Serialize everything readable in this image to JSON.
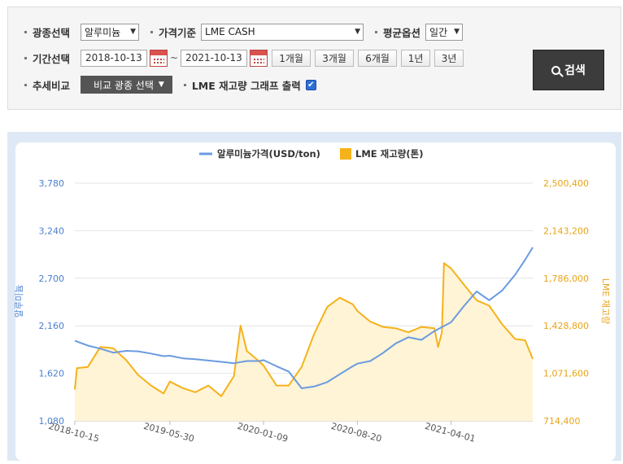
{
  "filters": {
    "metal_label": "광종선택",
    "metal_value": "알루미늄",
    "price_label": "가격기준",
    "price_value": "LME CASH",
    "avg_label": "평균옵션",
    "avg_value": "일간",
    "period_label": "기간선택",
    "date_from": "2018-10-13",
    "date_sep": "~",
    "date_to": "2021-10-13",
    "period_buttons": [
      "1개월",
      "3개월",
      "6개월",
      "1년",
      "3년"
    ],
    "trend_label": "추세비교",
    "compare_button": "비교 광종 선택",
    "inventory_label": "LME 재고량 그래프 출력",
    "inventory_checked": true,
    "search_button": "검색"
  },
  "chart_data": {
    "type": "line",
    "legend_position": "top-center",
    "grid": "horizontal",
    "series": [
      {
        "name": "알루미늄가격(USD/ton)",
        "axis": "left",
        "color": "#6a9be0",
        "x": [
          "2018-10-15",
          "2018-11-15",
          "2018-12-15",
          "2019-01-15",
          "2019-02-15",
          "2019-03-15",
          "2019-04-15",
          "2019-05-15",
          "2019-05-30",
          "2019-06-30",
          "2019-07-30",
          "2019-08-30",
          "2019-09-30",
          "2019-10-30",
          "2019-11-30",
          "2019-12-30",
          "2020-01-09",
          "2020-02-09",
          "2020-03-09",
          "2020-04-09",
          "2020-05-09",
          "2020-06-09",
          "2020-07-09",
          "2020-08-09",
          "2020-08-20",
          "2020-09-20",
          "2020-10-20",
          "2020-11-20",
          "2020-12-20",
          "2021-01-20",
          "2021-02-20",
          "2021-04-01",
          "2021-05-01",
          "2021-06-01",
          "2021-07-01",
          "2021-08-01",
          "2021-09-01",
          "2021-09-25",
          "2021-10-13"
        ],
        "y": [
          1990,
          1935,
          1900,
          1855,
          1875,
          1870,
          1845,
          1815,
          1820,
          1790,
          1780,
          1765,
          1750,
          1735,
          1760,
          1760,
          1770,
          1700,
          1640,
          1450,
          1470,
          1520,
          1610,
          1700,
          1730,
          1760,
          1850,
          1960,
          2030,
          2000,
          2100,
          2200,
          2380,
          2550,
          2450,
          2560,
          2740,
          2910,
          3050
        ]
      },
      {
        "name": "LME 재고량(톤)",
        "axis": "right",
        "color": "#f5b21b",
        "x": [
          "2018-10-15",
          "2018-10-20",
          "2018-11-15",
          "2018-12-15",
          "2019-01-15",
          "2019-02-15",
          "2019-03-15",
          "2019-04-15",
          "2019-05-15",
          "2019-05-30",
          "2019-06-30",
          "2019-07-30",
          "2019-08-30",
          "2019-09-30",
          "2019-10-30",
          "2019-11-15",
          "2019-11-30",
          "2019-12-30",
          "2020-01-09",
          "2020-02-09",
          "2020-03-09",
          "2020-04-09",
          "2020-05-09",
          "2020-06-09",
          "2020-07-09",
          "2020-08-09",
          "2020-08-20",
          "2020-09-20",
          "2020-10-20",
          "2020-11-20",
          "2020-12-20",
          "2021-01-20",
          "2021-02-20",
          "2021-03-01",
          "2021-03-10",
          "2021-03-15",
          "2021-04-01",
          "2021-05-01",
          "2021-06-01",
          "2021-07-01",
          "2021-08-01",
          "2021-09-01",
          "2021-09-25",
          "2021-10-13"
        ],
        "y": [
          950,
          1110,
          1120,
          1270,
          1260,
          1170,
          1060,
          980,
          920,
          1010,
          960,
          930,
          980,
          900,
          1050,
          1430,
          1240,
          1160,
          1130,
          980,
          980,
          1120,
          1370,
          1570,
          1640,
          1590,
          1540,
          1460,
          1420,
          1410,
          1380,
          1420,
          1410,
          1270,
          1380,
          1900,
          1860,
          1740,
          1620,
          1580,
          1440,
          1330,
          1320,
          1180
        ]
      }
    ],
    "x_ticks": [
      "2018-10-15",
      "2019-05-30",
      "2020-01-09",
      "2020-08-20",
      "2021-04-01"
    ],
    "y_left": {
      "label": "알루미늄",
      "min": 1080,
      "max": 3780,
      "ticks": [
        "1,080",
        "1,620",
        "2,160",
        "2,700",
        "3,240",
        "3,780"
      ]
    },
    "y_right": {
      "label": "LME 재고량",
      "min_thousand_t": 714.4,
      "max_thousand_t": 2500.4,
      "ticks": [
        "714,400",
        "1,071,600",
        "1,428,800",
        "1,786,000",
        "2,143,200",
        "2,500,400"
      ]
    },
    "colors": {
      "price_line": "#6a9be0",
      "stock_line": "#f5b21b",
      "stock_fill": "#fff4d6",
      "left_axis_text": "#4a7fd0",
      "right_axis_text": "#e8a417"
    }
  }
}
